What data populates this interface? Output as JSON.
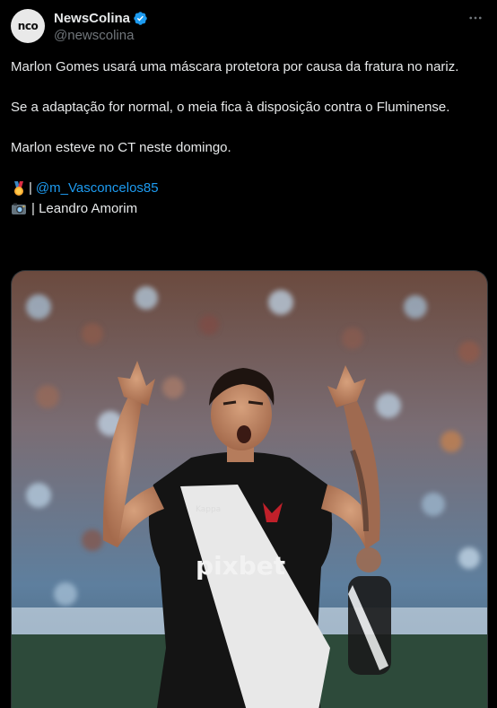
{
  "account": {
    "display_name": "NewsColina",
    "handle": "@newscolina",
    "avatar_text": "nco",
    "verified": true,
    "verified_color": "#1d9bf0"
  },
  "menu": {
    "icon": "more-horizontal-icon"
  },
  "tweet": {
    "paragraphs": [
      "Marlon Gomes usará uma máscara protetora por causa da fratura no nariz.",
      "Se a adaptação for normal, o meia fica à disposição contra o Fluminense.",
      "Marlon esteve no CT neste domingo."
    ],
    "credit_text": {
      "medal_icon": "medal-emoji-icon",
      "medal_sep": "|",
      "mention": "@m_Vasconcelos85",
      "camera_icon": "camera-emoji-icon",
      "camera_sep": "| Leandro Amorim"
    }
  },
  "photo": {
    "description_icon": "player-photo",
    "jersey_sponsor": "pixbet",
    "jersey_brand": "Kappa"
  },
  "colors": {
    "background": "#000000",
    "text": "#e7e9ea",
    "muted": "#71767b",
    "link": "#1d9bf0"
  }
}
